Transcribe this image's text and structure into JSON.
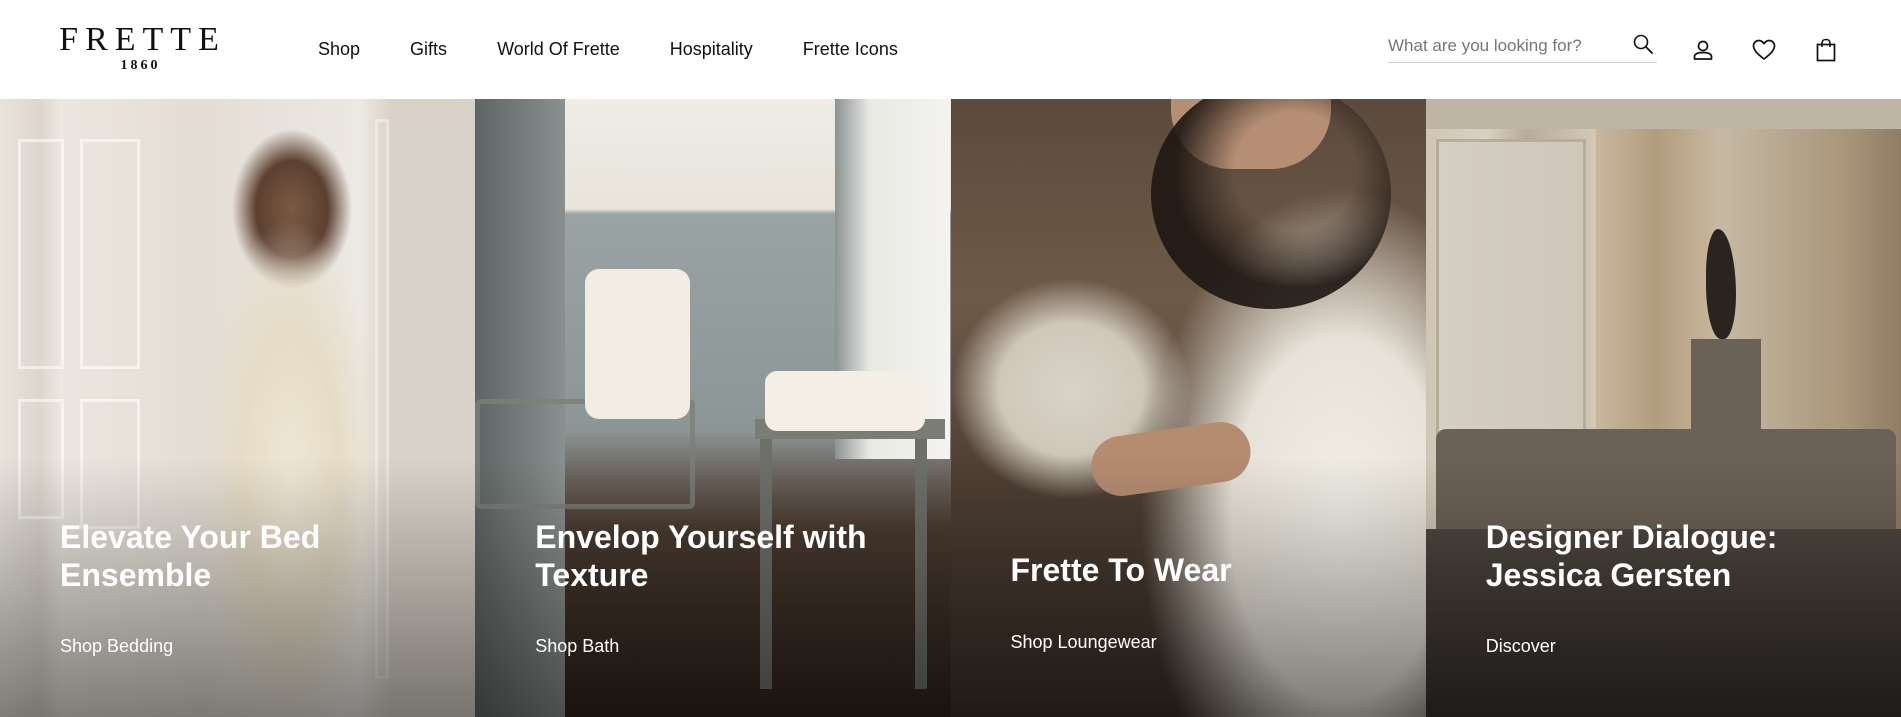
{
  "brand": {
    "name": "FRETTE",
    "year": "1860"
  },
  "nav": {
    "items": [
      {
        "label": "Shop"
      },
      {
        "label": "Gifts"
      },
      {
        "label": "World Of Frette"
      },
      {
        "label": "Hospitality"
      },
      {
        "label": "Frette Icons"
      }
    ]
  },
  "search": {
    "placeholder": "What are you looking for?",
    "value": ""
  },
  "icons": {
    "search": "search-icon",
    "account": "account-icon",
    "wishlist": "heart-icon",
    "bag": "shopping-bag-icon"
  },
  "tiles": [
    {
      "title": "Elevate Your Bed Ensemble",
      "link": "Shop Bedding"
    },
    {
      "title": "Envelop Yourself with Texture",
      "link": "Shop Bath"
    },
    {
      "title": "Frette To Wear",
      "link": "Shop Loungewear"
    },
    {
      "title": "Designer Dialogue: Jessica Gersten",
      "link": "Discover"
    }
  ],
  "colors": {
    "text": "#111111",
    "tile_text": "#ffffff",
    "search_underline": "#cfcfcf"
  }
}
